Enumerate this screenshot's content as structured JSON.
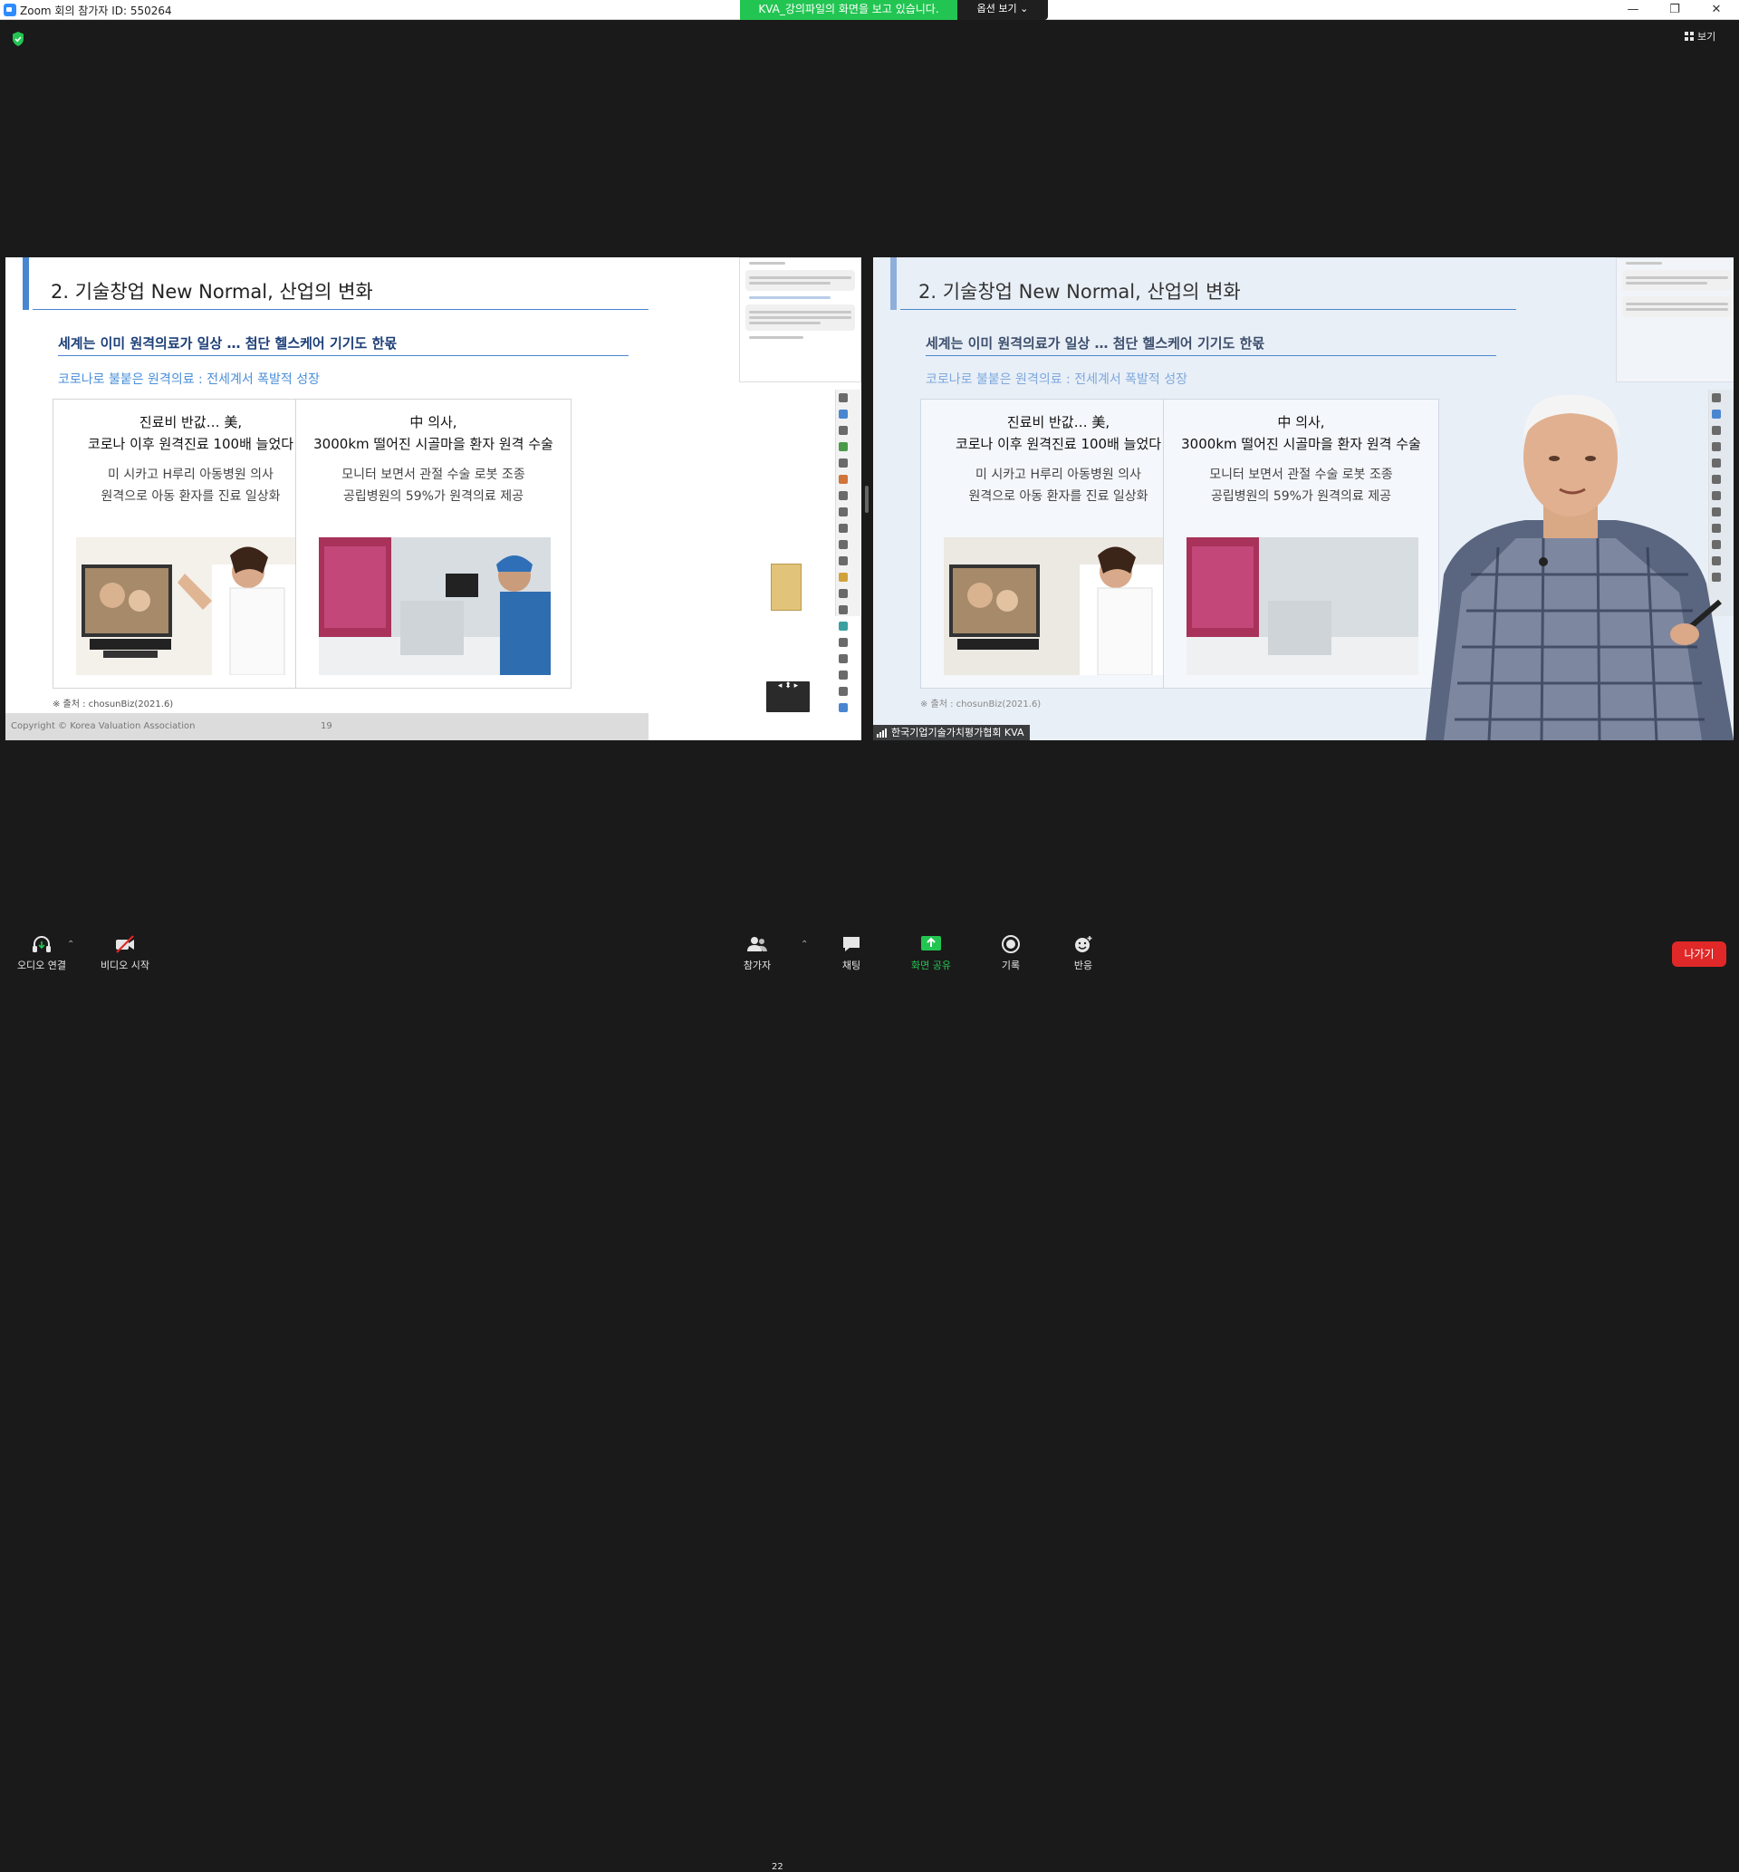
{
  "window": {
    "title": "Zoom 회의 참가자 ID: 550264",
    "share_banner": "KVA_강의파일의 화면을 보고 있습니다.",
    "view_options": "옵션 보기 ⌄",
    "view_button": "보기",
    "minimize": "—",
    "restore": "❐",
    "close": "✕"
  },
  "slide": {
    "title": "2. 기술창업 New Normal, 산업의 변화",
    "subtitle": "세계는 이미 원격의료가 일상 … 첨단 헬스케어 기기도 한몫",
    "blue_text": "코로나로 불붙은 원격의료 : 전세계서 폭발적 성장",
    "box1": {
      "heading1": "진료비 반값… 美,",
      "heading2": "코로나 이후 원격진료 100배 늘었다",
      "text1": "미 시카고 H루리 아동병원 의사",
      "text2": "원격으로 아동 환자를 진료 일상화"
    },
    "box2": {
      "heading1": "中 의사,",
      "heading2": "3000km 떨어진 시골마을 환자 원격 수술",
      "text1": "모니터 보면서 관절 수술 로봇 조종",
      "text2": "공립병원의 59%가 원격의료 제공"
    },
    "source": "※ 출처 : chosunBiz(2021.6)",
    "copyright": "Copyright © Korea Valuation Association",
    "page_number": "19"
  },
  "presenter": {
    "name": "한국기업기술가치평가협회 KVA"
  },
  "toolbar": {
    "audio": "오디오 연결",
    "video": "비디오 시작",
    "participants": "참가자",
    "participants_count": "22",
    "chat": "채팅",
    "share": "화면 공유",
    "record": "기록",
    "reactions": "반응",
    "leave": "나가기"
  }
}
